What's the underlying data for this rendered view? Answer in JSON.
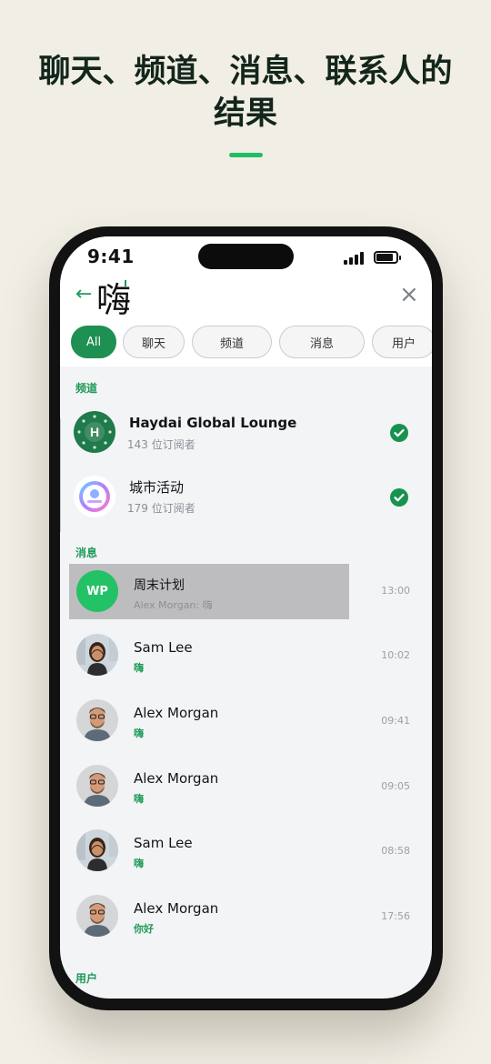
{
  "headline": {
    "line1": "聊天、频道、消息、联系人的",
    "line2": "结果"
  },
  "status_bar": {
    "time": "9:41"
  },
  "search": {
    "query": "嗨"
  },
  "filters": [
    {
      "label": "All",
      "active": true
    },
    {
      "label": "聊天",
      "active": false
    },
    {
      "label": "频道",
      "active": false
    },
    {
      "label": "消息",
      "active": false
    },
    {
      "label": "用户",
      "active": false
    }
  ],
  "sections": {
    "channels": "频道",
    "messages": "消息",
    "users": "用户"
  },
  "channels": [
    {
      "name": "Haydai Global Lounge",
      "subscribers": "143 位订阅者",
      "avatar": "H",
      "joined": true
    },
    {
      "name": "城市活动",
      "subscribers": "179 位订阅者",
      "avatar": "city-events-logo",
      "joined": true
    }
  ],
  "messages": [
    {
      "title": "周末计划",
      "snippet": "Alex Morgan: 嗨",
      "time": "13:00",
      "avatar_initials": "WP"
    },
    {
      "title": "Sam Lee",
      "snippet": "嗨",
      "time": "10:02",
      "avatar": "woman-photo"
    },
    {
      "title": "Alex Morgan",
      "snippet": "嗨",
      "time": "09:41",
      "avatar": "man-photo"
    },
    {
      "title": "Alex Morgan",
      "snippet": "嗨",
      "time": "09:05",
      "avatar": "man-photo"
    },
    {
      "title": "Sam Lee",
      "snippet": "嗨",
      "time": "08:58",
      "avatar": "woman-photo"
    },
    {
      "title": "Alex Morgan",
      "snippet": "你好",
      "time": "17:56",
      "avatar": "man-photo"
    }
  ],
  "colors": {
    "accent": "#1d9052",
    "background": "#f1eee5",
    "highlight": "#bdbdbf"
  }
}
